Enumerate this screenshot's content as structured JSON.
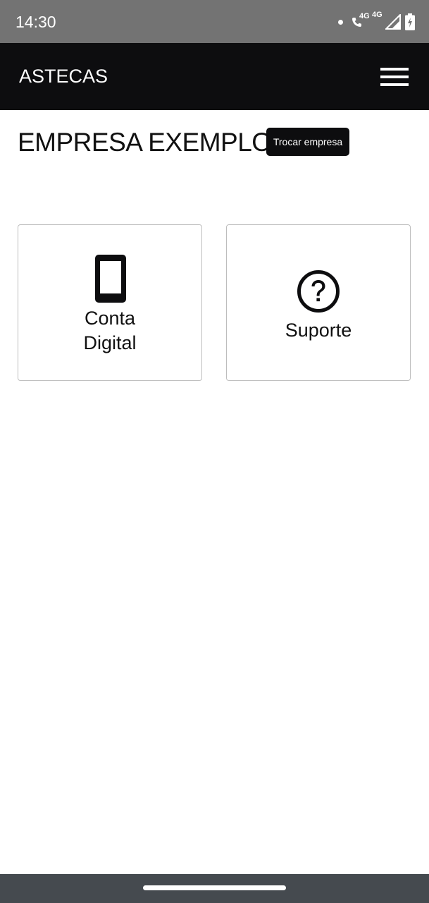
{
  "status_bar": {
    "time": "14:30",
    "network_label_1": "4G",
    "network_label_2": "4G",
    "icons": [
      "notification-dot-icon",
      "wifi-calling-icon",
      "signal-icon",
      "battery-charging-icon"
    ]
  },
  "header": {
    "brand": "ASTECAS",
    "menu_icon": "hamburger-menu-icon",
    "background": "#0d0d0f"
  },
  "company": {
    "name": "EMPRESA EXEMPLO",
    "switch_button_label": "Trocar empresa"
  },
  "cards": {
    "digital_account": {
      "label_line1": "Conta",
      "label_line2": "Digital",
      "icon": "smartphone-icon"
    },
    "support": {
      "label": "Suporte",
      "icon": "help-circle-icon"
    }
  },
  "colors": {
    "status_bar": "#737373",
    "header": "#0d0d0f",
    "nav_bar": "#454a4f",
    "card_border": "#bdbdbd"
  }
}
